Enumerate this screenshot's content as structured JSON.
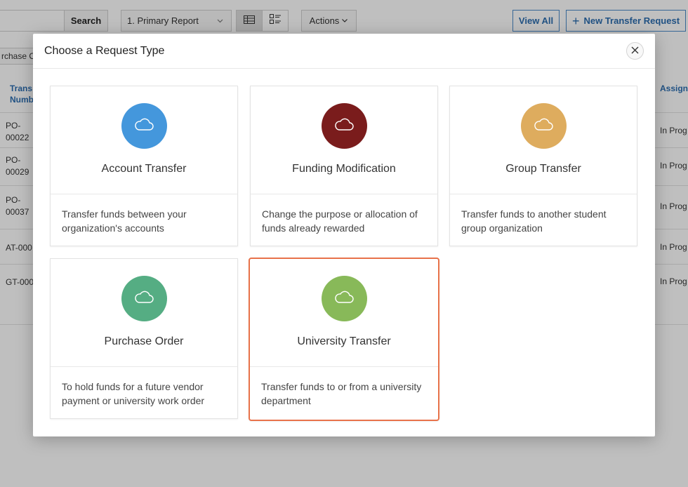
{
  "toolbar": {
    "search_label": "Search",
    "report_select_value": "1. Primary Report",
    "actions_label": "Actions",
    "view_all_label": "View All",
    "new_transfer_label": "New Transfer Request"
  },
  "filter": {
    "chip_label": "rchase O"
  },
  "table": {
    "left_header": "Trans Numb",
    "right_header": "Assign Gro",
    "rows": [
      {
        "id": "PO-00022",
        "status": "In Prog"
      },
      {
        "id": "PO-00029",
        "status": "In Prog"
      },
      {
        "id": "PO-00037",
        "status": "In Prog"
      },
      {
        "id": "AT-000",
        "status": "In Prog"
      },
      {
        "id": "GT-000",
        "status": "In Prog"
      }
    ]
  },
  "modal": {
    "title": "Choose a Request Type",
    "cards": [
      {
        "title": "Account Transfer",
        "description": "Transfer funds between your organization's accounts",
        "color": "#4497dc",
        "icon": "cloud-icon",
        "selected": false
      },
      {
        "title": "Funding Modification",
        "description": "Change the purpose or allocation of funds already rewarded",
        "color": "#7a1c1c",
        "icon": "cloud-icon",
        "selected": false
      },
      {
        "title": "Group Transfer",
        "description": "Transfer funds to another student group organization",
        "color": "#deac5e",
        "icon": "cloud-icon",
        "selected": false
      },
      {
        "title": "Purchase Order",
        "description": "To hold funds for a future vendor payment or university work order",
        "color": "#55ad83",
        "icon": "cloud-icon",
        "selected": false
      },
      {
        "title": "University Transfer",
        "description": "Transfer funds to or from a university department",
        "color": "#88b959",
        "icon": "cloud-icon",
        "selected": true
      }
    ]
  },
  "colors": {
    "accent_link": "#2d6eb0",
    "selected_border": "#e8724a"
  }
}
